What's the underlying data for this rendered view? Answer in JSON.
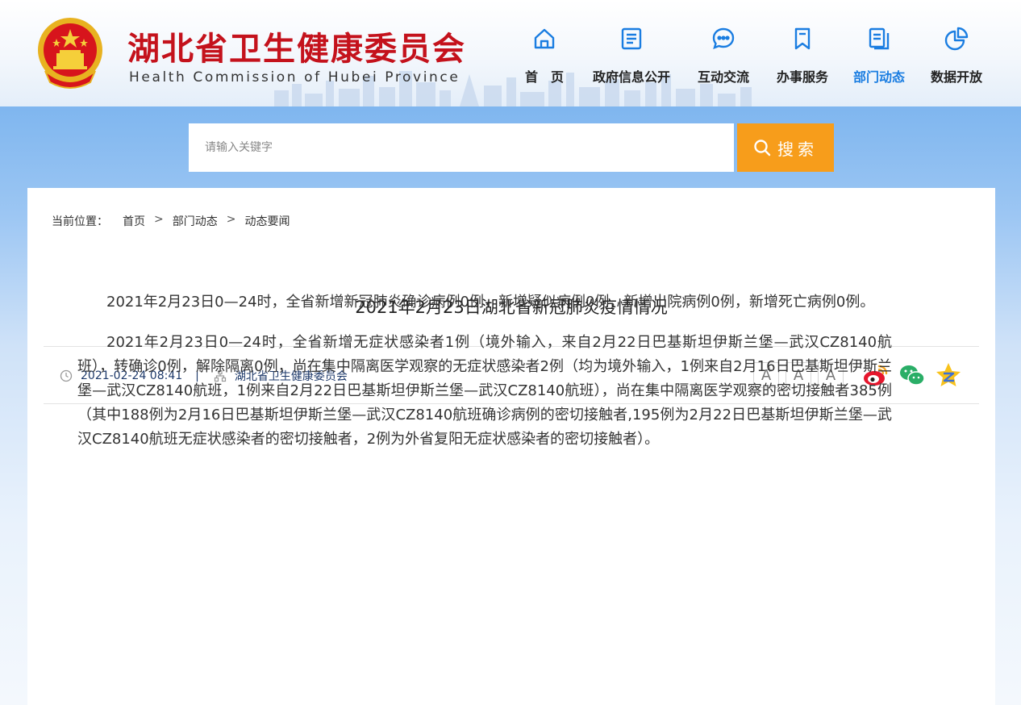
{
  "site": {
    "title": "湖北省卫生健康委员会",
    "subtitle": "Health Commission of Hubei Province"
  },
  "nav": [
    {
      "label": "首　页",
      "icon": "home-icon",
      "active": false
    },
    {
      "label": "政府信息公开",
      "icon": "document-list-icon",
      "active": false
    },
    {
      "label": "互动交流",
      "icon": "chat-bubble-icon",
      "active": false
    },
    {
      "label": "办事服务",
      "icon": "bookmark-icon",
      "active": false
    },
    {
      "label": "部门动态",
      "icon": "news-copy-icon",
      "active": true
    },
    {
      "label": "数据开放",
      "icon": "pie-chart-icon",
      "active": false
    }
  ],
  "search": {
    "placeholder": "请输入关键字",
    "button_label": "搜索"
  },
  "breadcrumb": {
    "label": "当前位置：",
    "items": [
      "首页",
      "部门动态",
      "动态要闻"
    ],
    "separator": ">"
  },
  "article": {
    "title": "2021年2月23日湖北省新冠肺炎疫情情况",
    "date": "2021-02-24 08:41",
    "meta_separator": "|",
    "source": "湖北省卫生健康委员会",
    "paragraphs": [
      "2021年2月23日0—24时，全省新增新冠肺炎确诊病例0例，新增疑似病例0例，新增出院病例0例，新增死亡病例0例。",
      "2021年2月23日0—24时，全省新增无症状感染者1例（境外输入，来自2月22日巴基斯坦伊斯兰堡—武汉CZ8140航班），转确诊0例，解除隔离0例，尚在集中隔离医学观察的无症状感染者2例（均为境外输入，1例来自2月16日巴基斯坦伊斯兰堡—武汉CZ8140航班，1例来自2月22日巴基斯坦伊斯兰堡—武汉CZ8140航班），尚在集中隔离医学观察的密切接触者385例（其中188例为2月16日巴基斯坦伊斯兰堡—武汉CZ8140航班确诊病例的密切接触者,195例为2月22日巴基斯坦伊斯兰堡—武汉CZ8140航班无症状感染者的密切接触者，2例为外省复阳无症状感染者的密切接触者）。"
    ]
  },
  "font_size_buttons": [
    {
      "letter": "A",
      "mark": "+"
    },
    {
      "letter": "A",
      "mark": "-"
    },
    {
      "letter": "A",
      "mark": ""
    }
  ],
  "share_icons": [
    "weibo-icon",
    "wechat-icon",
    "qzone-icon"
  ],
  "colors": {
    "brand_red": "#c4121c",
    "nav_active": "#1a7de1",
    "search_button": "#f79d1b",
    "meta_text": "#1e3a6b"
  }
}
